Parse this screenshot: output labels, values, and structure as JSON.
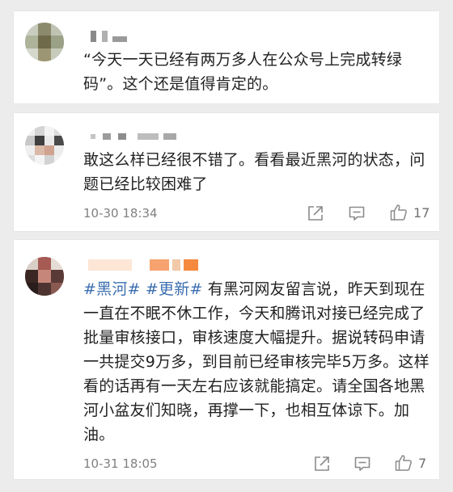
{
  "comments": [
    {
      "text": "“今天一天已经有两万多人在公众号上完成转绿码”。这个还是值得肯定的。"
    },
    {
      "text": "敢这么样已经很不错了。看看最近黑河的状态，问题已经比较困难了",
      "time": "10-30 18:34",
      "likes": "17"
    },
    {
      "hashtags": [
        "#黑河#",
        "#更新#"
      ],
      "text": "有黑河网友留言说，昨天到现在一直在不眠不休工作，今天和腾讯对接已经完成了批量审核接口，审核速度大幅提升。据说转码申请一共提交9万多，到目前已经审核完毕5万多。这样看的话再有一天左右应该就能搞定。请全国各地黑河小盆友们知晓，再撑一下，也相互体谅下。加油。",
      "time": "10-31 18:05",
      "likes": "7"
    }
  ],
  "icons": {
    "share": "share-icon",
    "comment": "comment-icon",
    "like": "thumbs-up-icon"
  },
  "colors": {
    "hashtag": "#3c6fb0",
    "text": "#222222",
    "meta": "#808080",
    "background": "#ececec"
  }
}
